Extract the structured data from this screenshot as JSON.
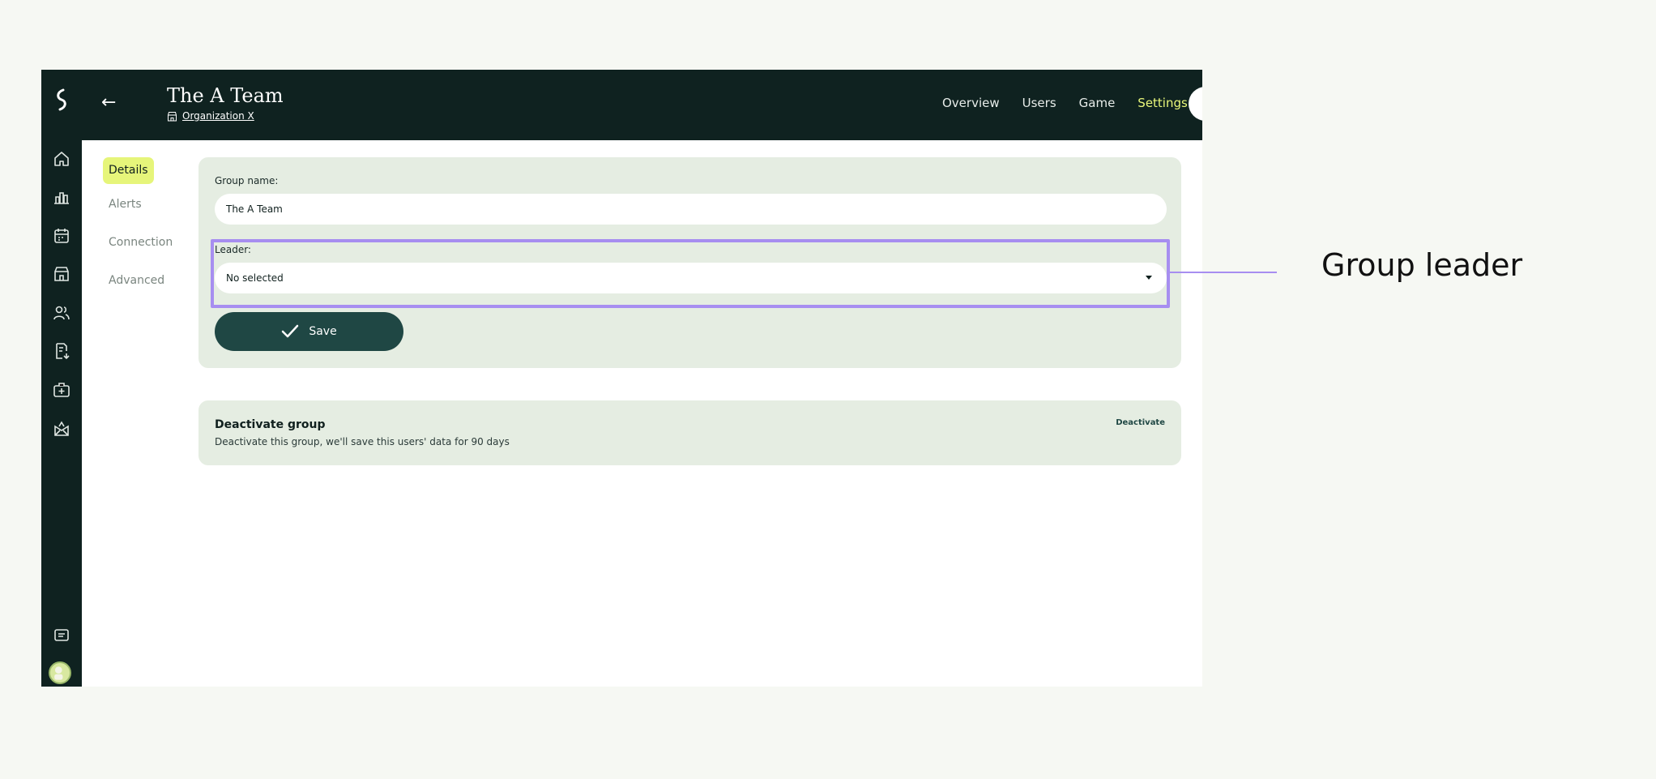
{
  "header": {
    "title": "The A Team",
    "organization": "Organization X",
    "nav": [
      "Overview",
      "Users",
      "Game",
      "Settings"
    ],
    "active_nav": "Settings"
  },
  "subnav": {
    "items": [
      "Details",
      "Alerts",
      "Connection",
      "Advanced"
    ],
    "active": "Details"
  },
  "details": {
    "group_name_label": "Group name:",
    "group_name_value": "The A Team",
    "leader_label": "Leader:",
    "leader_value": "No selected",
    "save_label": "Save"
  },
  "deactivate": {
    "title": "Deactivate group",
    "description": "Deactivate this group, we'll save this users' data for 90 days",
    "button": "Deactivate"
  },
  "annotation": {
    "label": "Group leader",
    "color": "#a78ef0"
  },
  "colors": {
    "dark": "#0f2220",
    "accent": "#e6f57a",
    "card": "#e5ede2",
    "button": "#1f4744"
  }
}
